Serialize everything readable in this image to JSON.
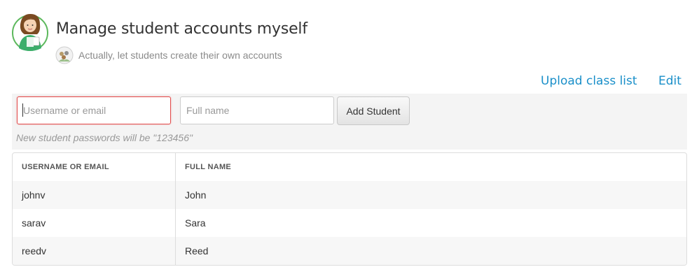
{
  "header": {
    "title": "Manage student accounts myself",
    "alt_option": "Actually, let students create their own accounts",
    "avatar_icon": "teacher-avatar-icon",
    "alt_icon": "students-group-icon"
  },
  "actions": {
    "upload_label": "Upload class list",
    "edit_label": "Edit",
    "link_color": "#1a8fc9"
  },
  "add_form": {
    "username_placeholder": "Username or email",
    "fullname_placeholder": "Full name",
    "add_label": "Add Student",
    "password_hint": "New student passwords will be \"123456\""
  },
  "table": {
    "headers": [
      "USERNAME OR EMAIL",
      "FULL NAME"
    ],
    "rows": [
      {
        "username": "johnv",
        "fullname": "John"
      },
      {
        "username": "sarav",
        "fullname": "Sara"
      },
      {
        "username": "reedv",
        "fullname": "Reed"
      }
    ]
  }
}
